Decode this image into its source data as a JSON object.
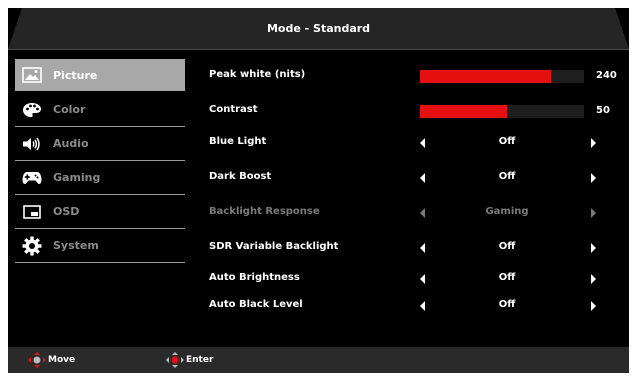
{
  "header": {
    "title": "Mode - Standard"
  },
  "sidebar": {
    "items": [
      {
        "label": "Picture",
        "icon": "picture-icon",
        "active": true
      },
      {
        "label": "Color",
        "icon": "palette-icon",
        "active": false
      },
      {
        "label": "Audio",
        "icon": "speaker-icon",
        "active": false
      },
      {
        "label": "Gaming",
        "icon": "gamepad-icon",
        "active": false
      },
      {
        "label": "OSD",
        "icon": "osd-window-icon",
        "active": false
      },
      {
        "label": "System",
        "icon": "gear-icon",
        "active": false
      }
    ]
  },
  "settings": {
    "peak_white": {
      "label": "Peak white (nits)",
      "value": "240",
      "fraction": 0.8
    },
    "contrast": {
      "label": "Contrast",
      "value": "50",
      "fraction": 0.53
    },
    "blue_light": {
      "label": "Blue Light",
      "value": "Off"
    },
    "dark_boost": {
      "label": "Dark Boost",
      "value": "Off"
    },
    "backlight_response": {
      "label": "Backlight Response",
      "value": "Gaming",
      "disabled": true
    },
    "sdr_variable_backlight": {
      "label": "SDR Variable Backlight",
      "value": "Off"
    },
    "auto_brightness": {
      "label": "Auto Brightness",
      "value": "Off"
    },
    "auto_black_level": {
      "label": "Auto Black Level",
      "value": "Off"
    }
  },
  "footer": {
    "move_label": "Move",
    "enter_label": "Enter"
  },
  "colors": {
    "accent": "#e61010",
    "active_item_bg": "#a8a8a8",
    "header_bg": "#252525"
  }
}
